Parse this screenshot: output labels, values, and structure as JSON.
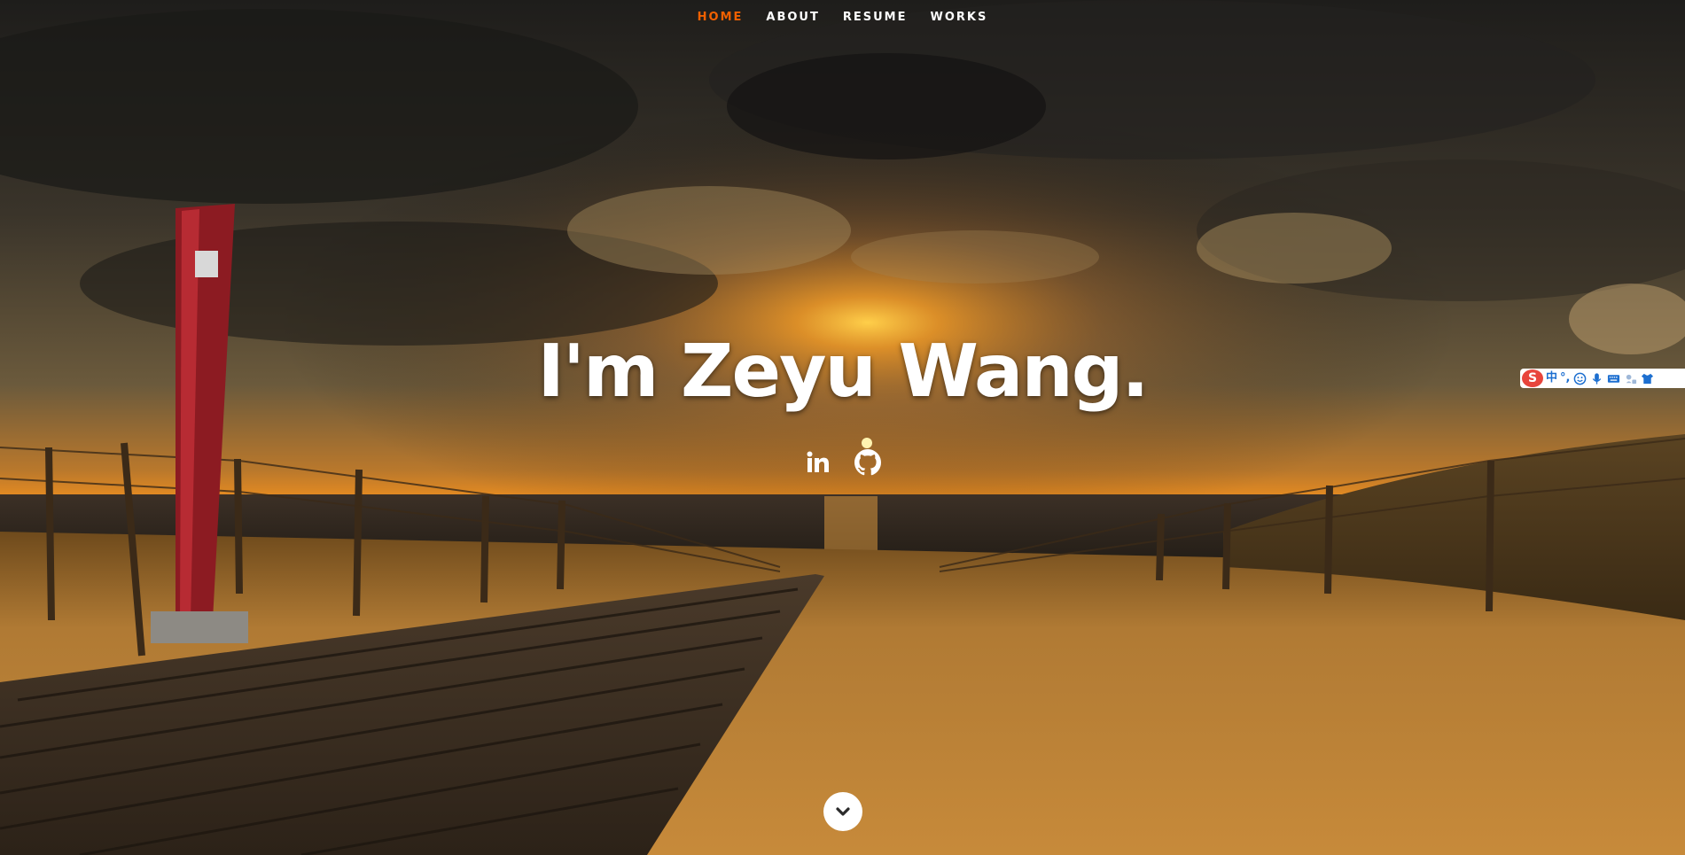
{
  "nav": {
    "items": [
      {
        "label": "HOME",
        "current": true
      },
      {
        "label": "ABOUT",
        "current": false
      },
      {
        "label": "RESUME",
        "current": false
      },
      {
        "label": "WORKS",
        "current": false
      }
    ]
  },
  "hero": {
    "headline": "I'm Zeyu Wang.",
    "background_image": "beach-boardwalk-sunset-photo"
  },
  "social": [
    {
      "icon": "linkedin-icon",
      "label": "in"
    },
    {
      "icon": "github-icon"
    }
  ],
  "scroll_down": {
    "icon": "chevron-down-icon"
  },
  "ime_toolbar": {
    "logo": "S",
    "mode_label": "中",
    "punct_label": "°,",
    "icons": [
      "emoji-icon",
      "microphone-icon",
      "keyboard-icon",
      "tools-icon",
      "skin-icon"
    ]
  },
  "colors": {
    "nav_active": "#f06000",
    "nav_text": "#ffffff",
    "headline": "#ffffff",
    "ime_logo": "#e8453c",
    "ime_accent": "#1d6fd0"
  }
}
